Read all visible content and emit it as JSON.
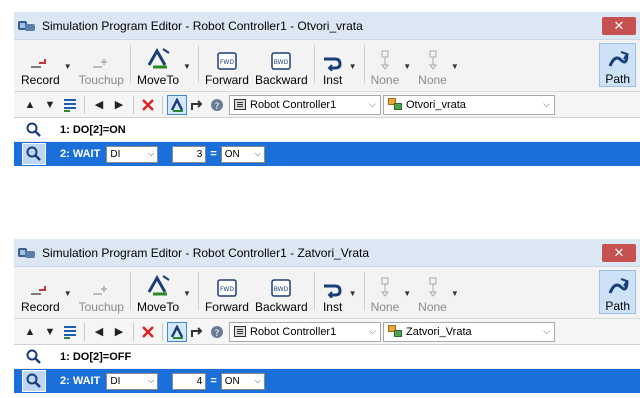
{
  "windows": [
    {
      "title": "Simulation Program Editor - Robot Controller1 - Otvori_vrata",
      "close": "✕",
      "ribbon": {
        "record": "Record",
        "touchup": "Touchup",
        "moveto": "MoveTo",
        "forward": "Forward",
        "backward": "Backward",
        "inst": "Inst",
        "none1": "None",
        "none2": "None",
        "path": "Path"
      },
      "toolbar": {
        "controller": "Robot Controller1",
        "program": "Otvori_vrata"
      },
      "lines": [
        {
          "text": "1:  DO[2]=ON"
        },
        {
          "prefix": "2:  WAIT",
          "signal": "DI",
          "index": "3",
          "eq": "=",
          "state": "ON"
        }
      ]
    },
    {
      "title": "Simulation Program Editor - Robot Controller1 - Zatvori_Vrata",
      "close": "✕",
      "ribbon": {
        "record": "Record",
        "touchup": "Touchup",
        "moveto": "MoveTo",
        "forward": "Forward",
        "backward": "Backward",
        "inst": "Inst",
        "none1": "None",
        "none2": "None",
        "path": "Path"
      },
      "toolbar": {
        "controller": "Robot Controller1",
        "program": "Zatvori_Vrata"
      },
      "lines": [
        {
          "text": "1:  DO[2]=OFF"
        },
        {
          "prefix": "2:  WAIT",
          "signal": "DI",
          "index": "4",
          "eq": "=",
          "state": "ON"
        }
      ]
    }
  ],
  "colors": {
    "selection": "#1b6fd8",
    "titlebar": "#dbe7f3",
    "close": "#c75050"
  }
}
